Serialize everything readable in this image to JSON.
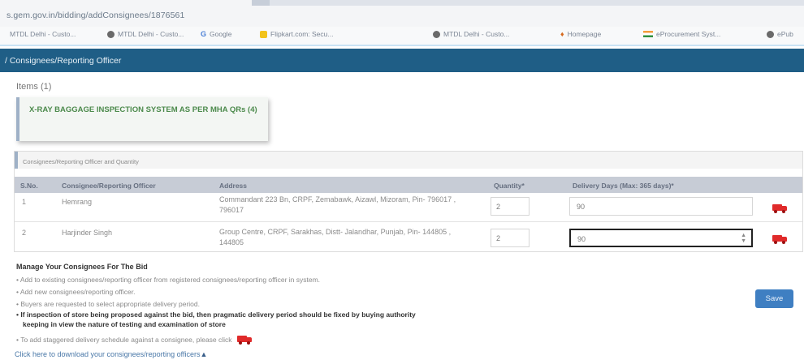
{
  "browser": {
    "url": "s.gem.gov.in/bidding/addConsignees/1876561",
    "bookmarks": [
      {
        "label": "MTDL Delhi - Custo...",
        "icon": "page-icon"
      },
      {
        "label": "MTDL Delhi - Custo...",
        "icon": "globe-icon"
      },
      {
        "label": "Google",
        "icon": "google-icon"
      },
      {
        "label": "Flipkart.com: Secu...",
        "icon": "flipkart-icon"
      },
      {
        "label": "MTDL Delhi - Custo...",
        "icon": "globe-icon"
      },
      {
        "label": "Homepage",
        "icon": "homepage-icon"
      },
      {
        "label": "eProcurement Syst...",
        "icon": "india-flag-icon"
      },
      {
        "label": "ePub",
        "icon": "globe-icon"
      }
    ]
  },
  "header": {
    "title": "/ Consignees/Reporting Officer"
  },
  "items": {
    "title": "Items (1)",
    "card_text": "X-RAY BAGGAGE INSPECTION SYSTEM AS PER MHA QRs (4)"
  },
  "section": {
    "title": "Consignees/Reporting Officer and Quantity"
  },
  "table": {
    "headers": [
      "S.No.",
      "Consignee/Reporting Officer",
      "Address",
      "Quantity*",
      "Delivery Days (Max: 365 days)*"
    ],
    "rows": [
      {
        "sno": "1",
        "officer": "Hemrang",
        "address": "Commandant 223 Bn, CRPF, Zemabawk, Aizawl, Mizoram, Pin- 796017 , 796017",
        "quantity": "2",
        "delivery_days": "90"
      },
      {
        "sno": "2",
        "officer": "Harjinder Singh",
        "address": "Group Centre, CRPF, Sarakhas, Distt- Jalandhar, Punjab, Pin- 144805 , 144805",
        "quantity": "2",
        "delivery_days": "90"
      }
    ]
  },
  "notes": {
    "title": "Manage Your Consignees For The Bid",
    "items": [
      "Add to existing consignees/reporting officer from registered consignees/reporting officer in system.",
      "Add new consignees/reporting officer.",
      "Buyers are requested to select appropriate delivery period.",
      "If inspection of store being proposed against the bid, then pragmatic delivery period should be fixed by buying authority",
      "keeping in view the nature of testing and examination of store",
      "To add staggered delivery schedule against a consignee, please click"
    ],
    "download_link": "Click here to download your consignees/reporting officers"
  },
  "actions": {
    "save_label": "Save"
  },
  "colors": {
    "header": "#1f5e86",
    "save": "#3f7fc2",
    "truck": "#e02a2a"
  }
}
